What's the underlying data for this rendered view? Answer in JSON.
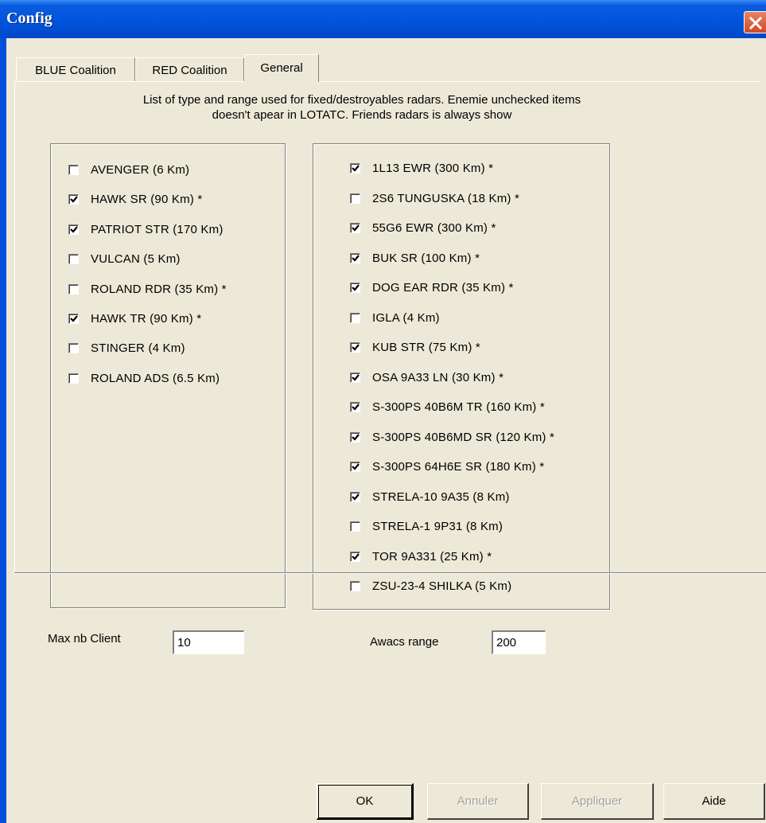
{
  "window": {
    "title": "Config"
  },
  "tabs": [
    {
      "label": "BLUE Coalition"
    },
    {
      "label": "RED Coalition"
    },
    {
      "label": "General"
    }
  ],
  "description": {
    "line1": "List of type and range used for fixed/destroyables radars. Enemie unchecked items",
    "line2": "doesn't apear in LOTATC. Friends radars is always show"
  },
  "left_radars": [
    {
      "label": "AVENGER (6 Km)",
      "checked": false
    },
    {
      "label": "HAWK SR (90 Km) *",
      "checked": true
    },
    {
      "label": "PATRIOT STR (170 Km)",
      "checked": true
    },
    {
      "label": "VULCAN (5 Km)",
      "checked": false
    },
    {
      "label": "ROLAND RDR (35 Km) *",
      "checked": false
    },
    {
      "label": "HAWK TR (90 Km) *",
      "checked": true
    },
    {
      "label": "STINGER (4 Km)",
      "checked": false
    },
    {
      "label": "ROLAND ADS (6.5 Km)",
      "checked": false
    }
  ],
  "right_radars": [
    {
      "label": "1L13 EWR (300 Km) *",
      "checked": true
    },
    {
      "label": "2S6 TUNGUSKA (18 Km) *",
      "checked": false
    },
    {
      "label": "55G6 EWR (300 Km) *",
      "checked": true
    },
    {
      "label": "BUK SR (100 Km) *",
      "checked": true
    },
    {
      "label": "DOG EAR RDR (35 Km) *",
      "checked": true
    },
    {
      "label": "IGLA (4 Km)",
      "checked": false
    },
    {
      "label": "KUB STR (75 Km) *",
      "checked": true
    },
    {
      "label": "OSA 9A33 LN (30 Km) *",
      "checked": true
    },
    {
      "label": "S-300PS 40B6M TR (160 Km) *",
      "checked": true
    },
    {
      "label": "S-300PS 40B6MD SR (120 Km) *",
      "checked": true
    },
    {
      "label": "S-300PS 64H6E SR (180 Km) *",
      "checked": true
    },
    {
      "label": "STRELA-10 9A35 (8 Km)",
      "checked": true
    },
    {
      "label": "STRELA-1 9P31 (8 Km)",
      "checked": false
    },
    {
      "label": "TOR 9A331 (25 Km) *",
      "checked": true
    },
    {
      "label": "ZSU-23-4 SHILKA (5 Km)",
      "checked": false
    }
  ],
  "fields": {
    "max_client_label": "Max nb Client",
    "max_client_value": "10",
    "awacs_label": "Awacs range",
    "awacs_value": "200"
  },
  "buttons": {
    "ok": "OK",
    "cancel": "Annuler",
    "apply": "Appliquer",
    "help": "Aide"
  }
}
